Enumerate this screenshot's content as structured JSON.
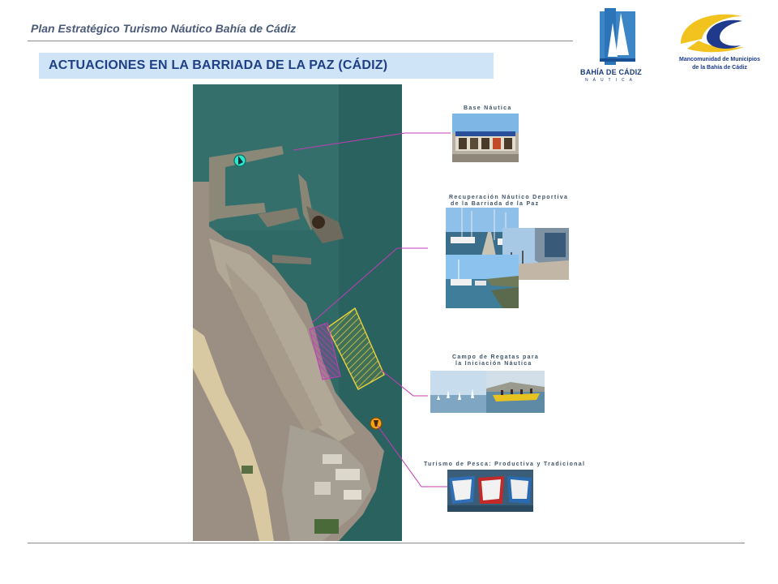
{
  "header": {
    "title": "Plan Estratégico Turismo Náutico Bahía de Cádiz"
  },
  "section": {
    "title": "ACTUACIONES EN LA BARRIADA DE LA PAZ (CÁDIZ)"
  },
  "logos": {
    "bahia_name": "BAHÍA DE CÁDIZ",
    "bahia_sub": "NÁUTICA",
    "manc_line1": "Mancomunidad de Municipios",
    "manc_line2": "de la Bahía de Cádiz"
  },
  "actuaciones": [
    {
      "lines": [
        "Base Náutica"
      ]
    },
    {
      "lines": [
        "Recuperación Náutico Deportiva",
        "de la Barriada de la Paz"
      ]
    },
    {
      "lines": [
        "Campo de Regatas para",
        "la Iniciación Náutica"
      ]
    },
    {
      "lines": [
        "Turismo de Pesca: Productiva y Tradicional"
      ]
    }
  ],
  "colors": {
    "title_text": "#1f3f86",
    "section_bg": "#cfe4f6",
    "connector": "#c23db8",
    "zone_yellow": "#e8d23c",
    "zone_magenta": "#c23db8",
    "marker_cyan": "#2ee6c8",
    "marker_orange": "#f5a21a"
  },
  "icons": [
    "sailboat-marker-icon",
    "fishing-marker-icon"
  ]
}
